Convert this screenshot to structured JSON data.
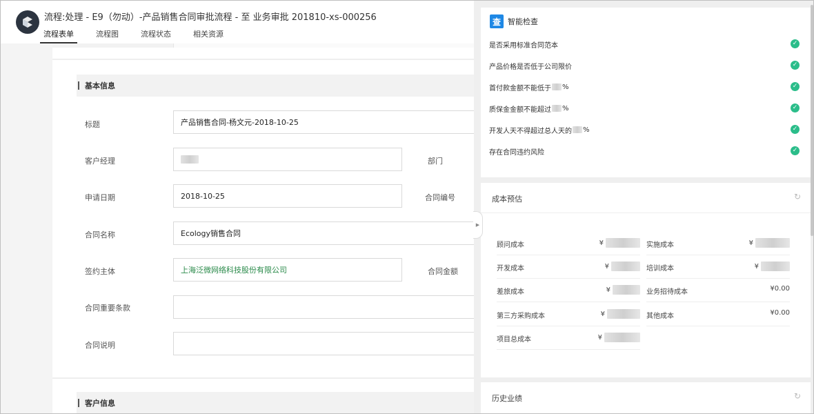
{
  "header": {
    "title": "流程:处理 - E9（勿动）-产品销售合同审批流程 - 至 业务审批 201810-xs-000256",
    "tabs": [
      "流程表单",
      "流程图",
      "流程状态",
      "相关资源"
    ],
    "active_tab": 0
  },
  "form": {
    "sections": [
      "基本信息",
      "客户信息"
    ],
    "fields": {
      "title": {
        "label": "标题",
        "value": "产品销售合同-杨文元-2018-10-25"
      },
      "manager": {
        "label": "客户经理",
        "value": ""
      },
      "department": {
        "label": "部门"
      },
      "apply_date": {
        "label": "申请日期",
        "value": "2018-10-25"
      },
      "contract_no": {
        "label": "合同编号"
      },
      "contract_name": {
        "label": "合同名称",
        "value": "Ecology销售合同"
      },
      "signing_party": {
        "label": "签约主体",
        "value": "上海泛微网络科技股份有限公司"
      },
      "contract_amount": {
        "label": "合同金额"
      },
      "key_terms": {
        "label": "合同重要条款",
        "value": ""
      },
      "description": {
        "label": "合同说明",
        "value": ""
      }
    }
  },
  "smart_check": {
    "icon": "查",
    "title": "智能检查",
    "items": [
      {
        "text": "是否采用标准合同范本",
        "suffix": "",
        "status": "ok"
      },
      {
        "text": "产品价格是否低于公司限价",
        "suffix": "",
        "status": "ok"
      },
      {
        "text": "首付款金额不能低于",
        "suffix": "%",
        "status": "ok"
      },
      {
        "text": "质保金金额不能超过",
        "suffix": "%",
        "status": "ok"
      },
      {
        "text": "开发人天不得超过总人天的",
        "suffix": "%",
        "status": "ok"
      },
      {
        "text": "存在合同违约风险",
        "suffix": "",
        "status": "ok"
      }
    ],
    "ok_glyph": "✓",
    "ok_color": "#2bbd8a"
  },
  "cost_estimate": {
    "title": "成本预估",
    "currency": "¥",
    "items": [
      {
        "label": "顾问成本",
        "value": ""
      },
      {
        "label": "实施成本",
        "value": ""
      },
      {
        "label": "开发成本",
        "value": ""
      },
      {
        "label": "培训成本",
        "value": ""
      },
      {
        "label": "差旅成本",
        "value": ""
      },
      {
        "label": "业务招待成本",
        "value": "¥0.00"
      },
      {
        "label": "第三方采购成本",
        "value": ""
      },
      {
        "label": "其他成本",
        "value": "¥0.00"
      },
      {
        "label": "项目总成本",
        "value": ""
      }
    ]
  },
  "history": {
    "title": "历史业绩"
  },
  "icons": {
    "refresh": "refresh-icon",
    "collapse": "collapse-arrow-icon"
  }
}
